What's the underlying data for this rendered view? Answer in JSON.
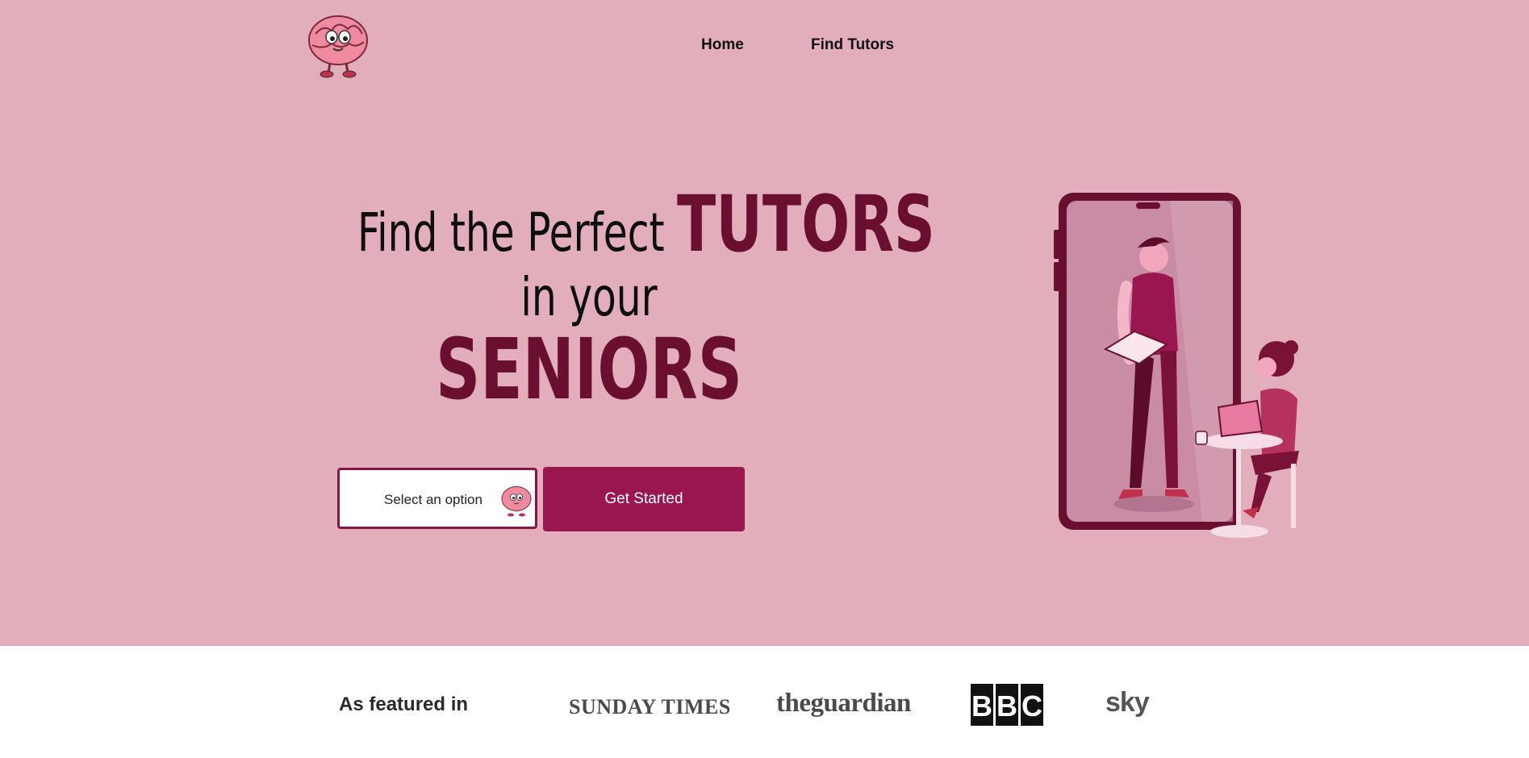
{
  "nav": {
    "home": "Home",
    "find_tutors": "Find Tutors"
  },
  "hero": {
    "line1_prefix": "Find the Perfect ",
    "line1_accent": "TUTORS",
    "line2": "in your",
    "line3": "SENIORS",
    "select_placeholder": "Select an option",
    "cta_label": "Get Started"
  },
  "featured": {
    "label": "As featured in",
    "outlets": [
      "SUNDAY TIMES",
      "theguardian",
      "BBC",
      "sky"
    ]
  },
  "colors": {
    "hero_bg": "#e3aebc",
    "accent_dark": "#6b0f30",
    "cta_bg": "#9a164f"
  },
  "icons": {
    "logo": "brain-mascot-icon",
    "select_icon": "brain-mascot-icon",
    "illustration": "tutor-phone-illustration"
  }
}
